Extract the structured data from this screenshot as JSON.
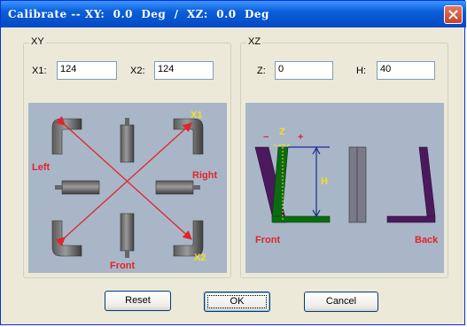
{
  "window": {
    "title": "Calibrate -- XY:  0.0  Deg  /  XZ:  0.0  Deg"
  },
  "xy_group": {
    "label": "XY",
    "x1_label": "X1:",
    "x1_value": "124",
    "x2_label": "X2:",
    "x2_value": "124",
    "diagram_labels": {
      "x1": "X1",
      "x2": "X2",
      "left": "Left",
      "right": "Right",
      "front": "Front"
    }
  },
  "xz_group": {
    "label": "XZ",
    "z_label": "Z:",
    "z_value": "0",
    "h_label": "H:",
    "h_value": "40",
    "diagram_labels": {
      "minus": "−",
      "z": "Z",
      "plus": "+",
      "h": "H",
      "front": "Front",
      "back": "Back"
    }
  },
  "buttons": {
    "reset": "Reset",
    "ok": "OK",
    "cancel": "Cancel"
  },
  "colors": {
    "arrow_red": "#e0242a",
    "label_yellow": "#f5e11b",
    "purple": "#4b1a5c",
    "green": "#0c6b12",
    "navy": "#1a2a8a"
  }
}
